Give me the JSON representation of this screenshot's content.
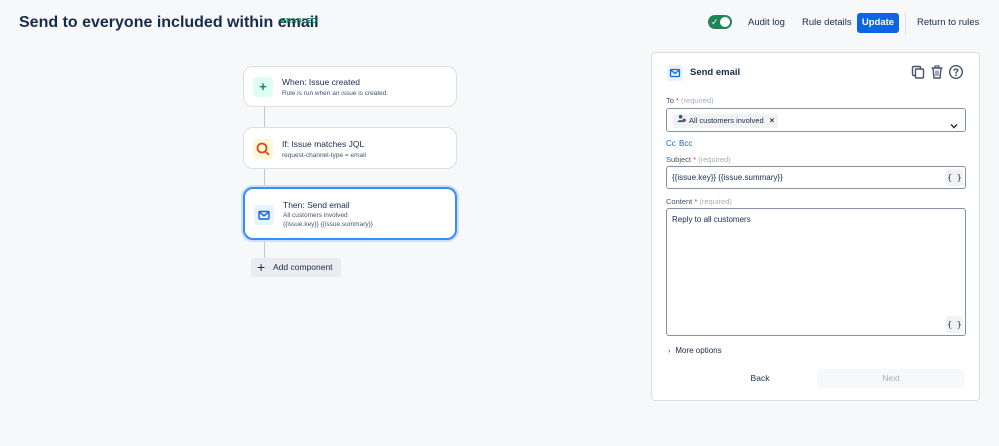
{
  "header": {
    "title": "Send to everyone included within email",
    "status_badge": "ENABLED",
    "audit_log_label": "Audit log",
    "rule_details_label": "Rule details",
    "update_label": "Update",
    "return_label": "Return to rules",
    "toggle_on": true
  },
  "flow": {
    "trigger": {
      "title": "When: Issue created",
      "subtitle": "Rule is run when an issue is created.",
      "icon": "plus-icon"
    },
    "condition": {
      "title": "If: Issue matches JQL",
      "subtitle": "request-channel-type = email",
      "icon": "search-icon"
    },
    "action": {
      "title": "Then: Send email",
      "line1": "All customers involved",
      "line2": "{{issue.key}} {{issue.summary}}",
      "icon": "mail-icon"
    },
    "add_component_label": "Add component"
  },
  "panel": {
    "title": "Send email",
    "to": {
      "label": "To",
      "required_mark": "*",
      "hint": "(required)",
      "chip": "All customers involved"
    },
    "cc_label": "Cc",
    "bcc_label": "Bcc",
    "subject": {
      "label": "Subject",
      "required_mark": "*",
      "hint": "(required)",
      "value": "{{issue.key}} {{issue.summary}}"
    },
    "content": {
      "label": "Content",
      "required_mark": "*",
      "hint": "(required)",
      "value": "Reply to all customers"
    },
    "brace_label": "{ }",
    "more_options_label": "More options",
    "back_label": "Back",
    "next_label": "Next"
  },
  "colors": {
    "accent": "#0c66e4",
    "enabled_green": "#1f845a",
    "selected_border": "#388bff"
  }
}
